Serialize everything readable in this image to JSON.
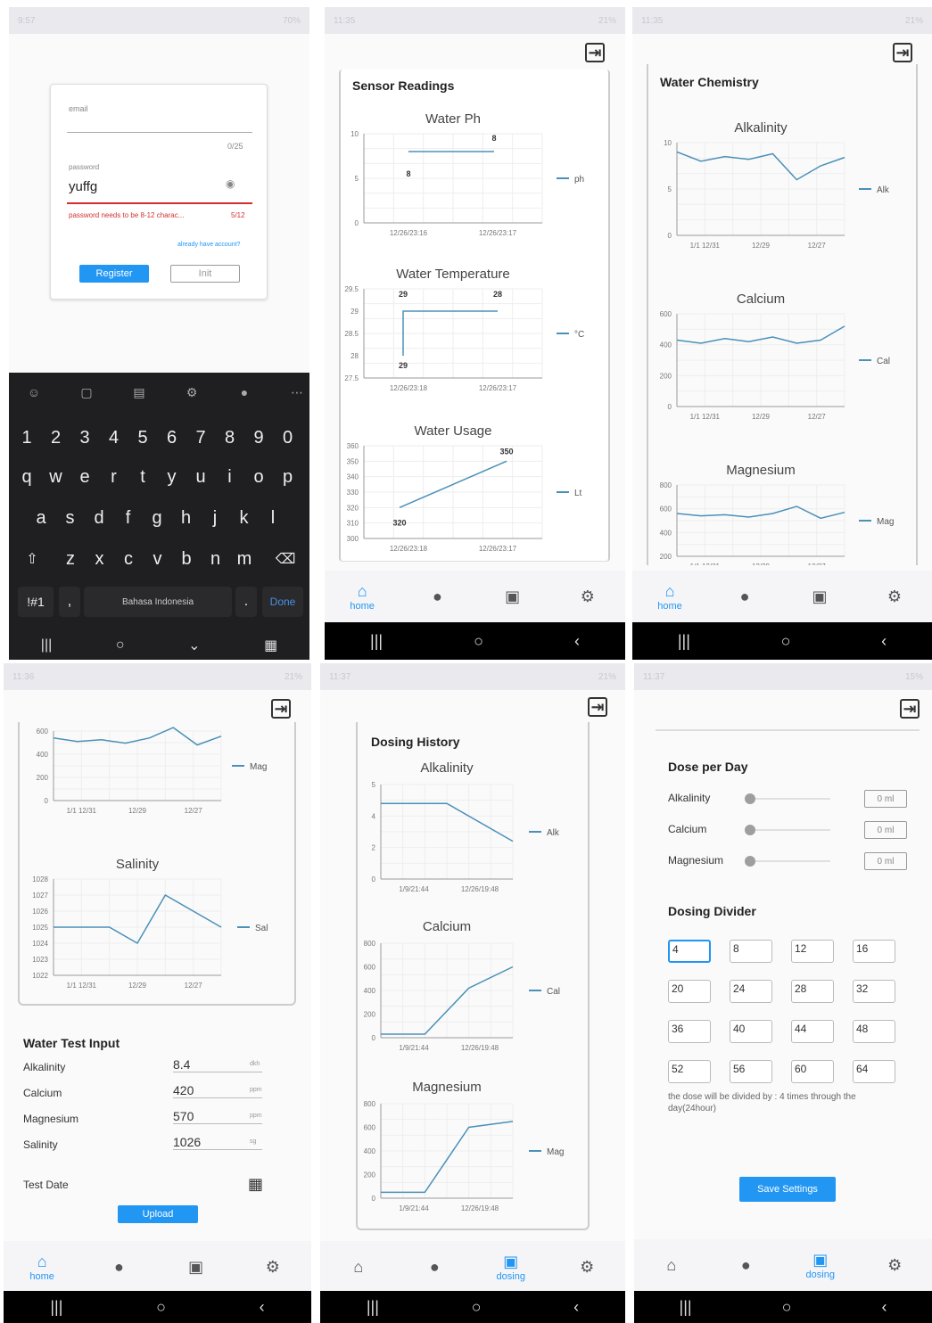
{
  "colors": {
    "accent": "#2196f3",
    "line": "#4a90b8",
    "error": "#d32f2f",
    "keyboard": "#1f1f21"
  },
  "screen1": {
    "status_time": "9:57",
    "status_right": "70%",
    "email_label": "email",
    "email_counter": "0/25",
    "password_label": "password",
    "password_value": "yuffg",
    "password_error": "password needs to be 8-12 charac...",
    "password_counter": "5/12",
    "already_account": "already have account?",
    "register_button": "Register",
    "secondary_button": "Init",
    "keyboard": {
      "numbers": [
        "1",
        "2",
        "3",
        "4",
        "5",
        "6",
        "7",
        "8",
        "9",
        "0"
      ],
      "row1": [
        "q",
        "w",
        "e",
        "r",
        "t",
        "y",
        "u",
        "i",
        "o",
        "p"
      ],
      "row2": [
        "a",
        "s",
        "d",
        "f",
        "g",
        "h",
        "j",
        "k",
        "l"
      ],
      "row3": [
        "z",
        "x",
        "c",
        "v",
        "b",
        "n",
        "m"
      ],
      "symbols_key": "!#1",
      "comma_key": ",",
      "space_label": "Bahasa Indonesia",
      "period_key": ".",
      "done_key": "Done"
    }
  },
  "screen2": {
    "status_time": "11:35",
    "status_right": "21%",
    "section_title": "Sensor Readings",
    "nav": {
      "home": "home"
    }
  },
  "screen3": {
    "status_time": "11:35",
    "status_right": "21%",
    "section_title": "Water Chemistry",
    "nav": {
      "home": "home"
    }
  },
  "screen4": {
    "status_time": "11:36",
    "status_right": "21%",
    "form_title": "Water Test Input",
    "fields": [
      {
        "label": "Alkalinity",
        "value": "8.4",
        "unit": "dkh"
      },
      {
        "label": "Calcium",
        "value": "420",
        "unit": "ppm"
      },
      {
        "label": "Magnesium",
        "value": "570",
        "unit": "ppm"
      },
      {
        "label": "Salinity",
        "value": "1026",
        "unit": "sg"
      }
    ],
    "test_date_label": "Test Date",
    "upload_button": "Upload",
    "nav": {
      "home": "home"
    }
  },
  "screen5": {
    "status_time": "11:37",
    "status_right": "21%",
    "section_title": "Dosing History",
    "nav": {
      "dosing": "dosing"
    }
  },
  "screen6": {
    "status_time": "11:37",
    "status_right": "15%",
    "dose_title": "Dose per Day",
    "dose_rows": [
      {
        "label": "Alkalinity",
        "value": "0",
        "unit": "ml"
      },
      {
        "label": "Calcium",
        "value": "0",
        "unit": "ml"
      },
      {
        "label": "Magnesium",
        "value": "0",
        "unit": "ml"
      }
    ],
    "divider_title": "Dosing Divider",
    "divider_options": [
      "4",
      "8",
      "12",
      "16",
      "20",
      "24",
      "28",
      "32",
      "36",
      "40",
      "44",
      "48",
      "52",
      "56",
      "60",
      "64"
    ],
    "divider_note": "the dose will be divided by : 4 times through the day(24hour)",
    "save_button": "Save Settings",
    "nav": {
      "dosing": "dosing"
    }
  },
  "chart_data": [
    {
      "type": "line",
      "title": "Water Ph",
      "x": [
        "12/26/23:16",
        "12/26/23:17"
      ],
      "series": [
        {
          "name": "ph",
          "values": [
            8,
            8
          ]
        }
      ],
      "data_labels": [
        "8",
        "8"
      ],
      "ylim": [
        0,
        10
      ],
      "yticks": [
        "10",
        "5",
        "0"
      ]
    },
    {
      "type": "line",
      "title": "Water Temperature",
      "x": [
        "12/26/23:18",
        "12/26/23:17"
      ],
      "series": [
        {
          "name": "°C",
          "values": [
            28,
            29,
            29
          ]
        }
      ],
      "data_labels": [
        "29",
        "29",
        "28"
      ],
      "ylim": [
        27.5,
        29.5
      ],
      "yticks": [
        "29.5",
        "29",
        "28.5",
        "28",
        "27.5"
      ]
    },
    {
      "type": "line",
      "title": "Water Usage",
      "x": [
        "12/26/23:18",
        "12/26/23:17"
      ],
      "series": [
        {
          "name": "Lt",
          "values": [
            320,
            350
          ]
        }
      ],
      "data_labels": [
        "320",
        "350"
      ],
      "ylim": [
        300,
        360
      ],
      "yticks": [
        "360",
        "350",
        "340",
        "330",
        "320",
        "310",
        "300"
      ]
    },
    {
      "type": "line",
      "title": "Alkalinity",
      "x": [
        "1/1 12/31",
        "12/29",
        "12/27"
      ],
      "series": [
        {
          "name": "Alk",
          "values": [
            9,
            8,
            8.5,
            8.2,
            8.8,
            6,
            7.5,
            8.4
          ]
        }
      ],
      "ylim": [
        0,
        10
      ],
      "yticks": [
        "10",
        "5",
        "0"
      ]
    },
    {
      "type": "line",
      "title": "Calcium",
      "x": [
        "1/1 12/31",
        "12/29",
        "12/27"
      ],
      "series": [
        {
          "name": "Cal",
          "values": [
            430,
            410,
            440,
            420,
            450,
            410,
            430,
            520
          ]
        }
      ],
      "ylim": [
        0,
        600
      ],
      "yticks": [
        "600",
        "400",
        "200",
        "0"
      ]
    },
    {
      "type": "line",
      "title": "Magnesium",
      "x": [
        "1/1 12/31",
        "12/29",
        "12/27"
      ],
      "series": [
        {
          "name": "Mag",
          "values": [
            560,
            540,
            550,
            530,
            560,
            620,
            520,
            570
          ]
        }
      ],
      "ylim": [
        200,
        800
      ],
      "yticks": [
        "800",
        "600",
        "400",
        "200"
      ]
    },
    {
      "type": "line",
      "title": "Salinity",
      "x": [
        "1/1 12/31",
        "12/29",
        "12/27"
      ],
      "series": [
        {
          "name": "Sal",
          "values": [
            1025,
            1025,
            1025,
            1024,
            1027,
            1026,
            1025
          ]
        }
      ],
      "ylim": [
        1022,
        1028
      ],
      "yticks": [
        "1028",
        "1027",
        "1026",
        "1025",
        "1024",
        "1023",
        "1022"
      ]
    },
    {
      "type": "line",
      "title": "Alkalinity",
      "x": [
        "1/9/21:44",
        "12/26/19:48"
      ],
      "series": [
        {
          "name": "Alk",
          "values": [
            4,
            4,
            2
          ]
        }
      ],
      "ylim": [
        0,
        5
      ],
      "yticks": [
        "5",
        "4",
        "2",
        "0"
      ]
    },
    {
      "type": "line",
      "title": "Calcium",
      "x": [
        "1/9/21:44",
        "12/26/19:48"
      ],
      "series": [
        {
          "name": "Cal",
          "values": [
            30,
            30,
            420,
            600
          ]
        }
      ],
      "ylim": [
        0,
        800
      ],
      "yticks": [
        "800",
        "600",
        "400",
        "200",
        "0"
      ]
    },
    {
      "type": "line",
      "title": "Magnesium",
      "x": [
        "1/9/21:44",
        "12/26/19:48"
      ],
      "series": [
        {
          "name": "Mag",
          "values": [
            50,
            50,
            600,
            650
          ]
        }
      ],
      "ylim": [
        0,
        800
      ],
      "yticks": [
        "800",
        "600",
        "400",
        "200",
        "0"
      ]
    }
  ]
}
